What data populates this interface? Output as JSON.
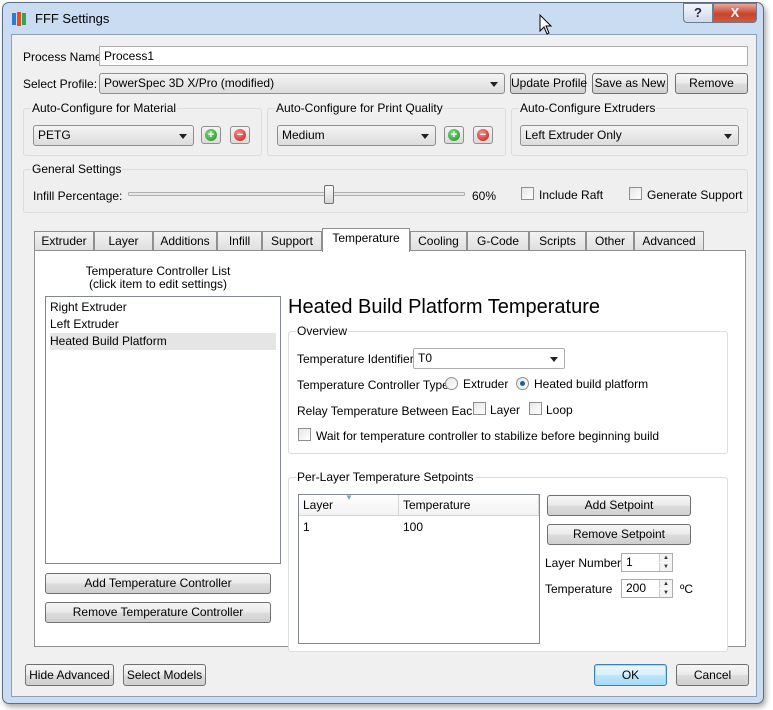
{
  "window": {
    "title": "FFF Settings",
    "help_label": "?",
    "close_label": "X"
  },
  "process": {
    "label": "Process Name:",
    "value": "Process1"
  },
  "profile": {
    "label": "Select Profile:",
    "value": "PowerSpec 3D X/Pro (modified)",
    "update_label": "Update Profile",
    "save_as_label": "Save as New",
    "remove_label": "Remove"
  },
  "material": {
    "title": "Auto-Configure for Material",
    "value": "PETG"
  },
  "quality": {
    "title": "Auto-Configure for Print Quality",
    "value": "Medium"
  },
  "extruders": {
    "title": "Auto-Configure Extruders",
    "value": "Left Extruder Only"
  },
  "general": {
    "title": "General Settings",
    "infill_label": "Infill Percentage:",
    "infill_value": "60%",
    "infill_fraction": 0.6,
    "raft_label": "Include Raft",
    "support_label": "Generate Support"
  },
  "tabs": [
    "Extruder",
    "Layer",
    "Additions",
    "Infill",
    "Support",
    "Temperature",
    "Cooling",
    "G-Code",
    "Scripts",
    "Other",
    "Advanced"
  ],
  "active_tab": "Temperature",
  "controller_list": {
    "title_line1": "Temperature Controller List",
    "title_line2": "(click item to edit settings)",
    "items": [
      "Right Extruder",
      "Left Extruder",
      "Heated Build Platform"
    ],
    "selected": "Heated Build Platform",
    "add_label": "Add Temperature Controller",
    "remove_label": "Remove Temperature Controller"
  },
  "detail": {
    "heading": "Heated Build Platform Temperature",
    "overview_title": "Overview",
    "identifier_label": "Temperature Identifier",
    "identifier_value": "T0",
    "type_label": "Temperature Controller Type:",
    "type_extruder": "Extruder",
    "type_platform": "Heated build platform",
    "relay_label": "Relay Temperature Between Each:",
    "relay_layer": "Layer",
    "relay_loop": "Loop",
    "wait_label": "Wait for temperature controller to stabilize before beginning build"
  },
  "setpoints": {
    "title": "Per-Layer Temperature Setpoints",
    "columns": [
      "Layer",
      "Temperature"
    ],
    "rows": [
      [
        "1",
        "100"
      ]
    ],
    "add_label": "Add Setpoint",
    "remove_label": "Remove Setpoint",
    "layer_number_label": "Layer Number",
    "layer_number_value": "1",
    "temperature_label": "Temperature",
    "temperature_value": "200",
    "unit": "ºC"
  },
  "footer": {
    "hide_advanced_label": "Hide Advanced",
    "select_models_label": "Select Models",
    "ok_label": "OK",
    "cancel_label": "Cancel"
  }
}
